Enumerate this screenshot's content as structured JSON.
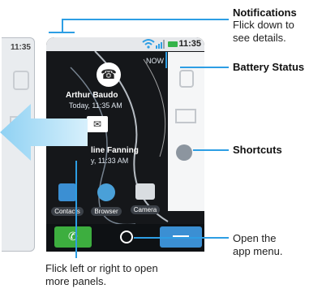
{
  "prev_panel": {
    "time": "11:35"
  },
  "status_bar": {
    "clock": "11:35"
  },
  "notifications_header": "NOW",
  "contacts": [
    {
      "name": "Arthur Baudo",
      "time": "Today, 11:35 AM"
    },
    {
      "name": "line Fanning",
      "time": "y, 11:33 AM"
    }
  ],
  "apps": [
    {
      "label": "Contacts",
      "icon": "contacts-icon"
    },
    {
      "label": "Browser",
      "icon": "globe-icon"
    },
    {
      "label": "Camera",
      "icon": "camera-icon"
    }
  ],
  "callouts": {
    "notifications_title": "Notifications",
    "notifications_line1": "Flick down to",
    "notifications_line2": "see details.",
    "battery_status": "Battery Status",
    "shortcuts": "Shortcuts",
    "open_menu_line1": "Open the",
    "open_menu_line2": "app menu.",
    "flick_line1": "Flick left or right to open",
    "flick_line2": "more panels."
  },
  "colors": {
    "accent": "#2d9ee4",
    "arrow": "#8fd1f3",
    "phone_green": "#3dae3f",
    "menu_blue": "#3b8fd3"
  }
}
